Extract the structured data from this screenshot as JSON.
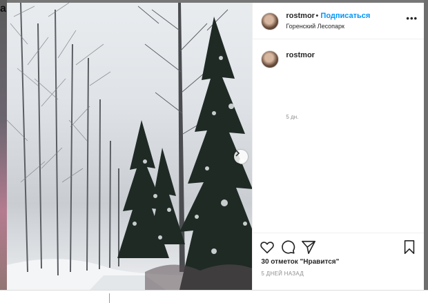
{
  "post": {
    "username": "rostmor",
    "dot": "•",
    "follow_label": "Подписаться",
    "location": "Горенский Лесопарк",
    "more_label": "•••",
    "caption_username": "rostmor",
    "time_ago": "5 дн.",
    "likes": "30 отметок \"Нравится\"",
    "date": "5 ДНЕЙ НАЗАД"
  },
  "backdrop": {
    "corner_glyph": "a"
  },
  "icons": {
    "like": "heart-icon",
    "comment": "comment-icon",
    "share": "share-icon",
    "save": "bookmark-icon",
    "next": "chevron-right-icon",
    "more": "more-options-icon"
  },
  "colors": {
    "accent": "#0095f6",
    "text": "#262626",
    "muted": "#8e8e8e"
  }
}
